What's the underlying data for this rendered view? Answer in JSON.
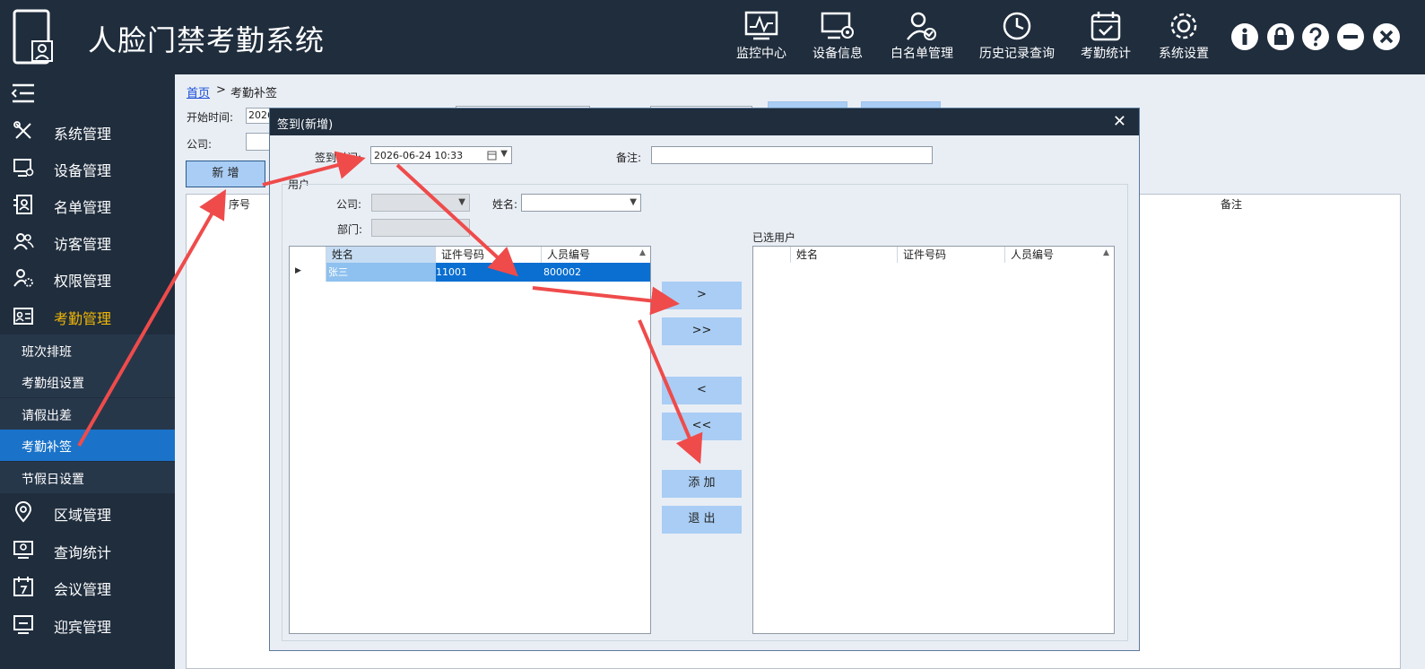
{
  "header": {
    "app_title": "人脸门禁考勤系统",
    "nav": [
      {
        "label": "监控中心",
        "icon": "monitor-chart-icon"
      },
      {
        "label": "设备信息",
        "icon": "device-icon"
      },
      {
        "label": "白名单管理",
        "icon": "user-check-icon"
      },
      {
        "label": "历史记录查询",
        "icon": "history-icon"
      },
      {
        "label": "考勤统计",
        "icon": "calendar-check-icon"
      },
      {
        "label": "系统设置",
        "icon": "gear-icon"
      }
    ],
    "window_buttons": [
      "info-icon",
      "lock-icon",
      "help-icon",
      "minimize-icon",
      "close-icon"
    ]
  },
  "sidebar": {
    "items": [
      {
        "label": "系统管理",
        "icon": "tools-icon"
      },
      {
        "label": "设备管理",
        "icon": "device-manage-icon"
      },
      {
        "label": "名单管理",
        "icon": "name-list-icon"
      },
      {
        "label": "访客管理",
        "icon": "visitor-icon"
      },
      {
        "label": "权限管理",
        "icon": "permission-icon"
      },
      {
        "label": "考勤管理",
        "icon": "attendance-icon"
      },
      {
        "label": "区域管理",
        "icon": "location-icon"
      },
      {
        "label": "查询统计",
        "icon": "query-icon"
      },
      {
        "label": "会议管理",
        "icon": "meeting-icon"
      },
      {
        "label": "迎宾管理",
        "icon": "welcome-icon"
      }
    ],
    "subitems": [
      "班次排班",
      "考勤组设置",
      "请假出差",
      "考勤补签",
      "节假日设置"
    ]
  },
  "main": {
    "breadcrumb_home": "首页",
    "breadcrumb_sep": ">",
    "breadcrumb_current": "考勤补签",
    "start_time_label": "开始时间:",
    "start_time_value": "2026",
    "company_label": "公司:",
    "add_button": "新  增",
    "table_headers": {
      "seq": "序号",
      "remark": "备注"
    }
  },
  "dialog": {
    "title": "签到(新增)",
    "close": "✕",
    "checkin_time_label": "签到时间:",
    "checkin_time_value": "2026-06-24 10:33",
    "remark_label": "备注:",
    "remark_value": "",
    "user_group_label": "用户",
    "company_label": "公司:",
    "name_label": "姓名:",
    "dept_label": "部门:",
    "users_grid": {
      "headers": [
        "姓名",
        "证件号码",
        "人员编号"
      ],
      "rows": [
        {
          "name": "张三",
          "id_no": "11001",
          "emp_no": "800002"
        }
      ]
    },
    "selected_label": "已选用户",
    "selected_grid": {
      "headers": [
        "姓名",
        "证件号码",
        "人员编号"
      ],
      "rows": []
    },
    "buttons": {
      "add_one": ">",
      "add_all": ">>",
      "remove_one": "<",
      "remove_all": "<<",
      "confirm": "添  加",
      "exit": "退  出"
    }
  },
  "colors": {
    "dark": "#1f2d3d",
    "accent": "#1a73c9",
    "active_text": "#f2b705",
    "button": "#a9cdf4",
    "annotation": "#ef4b4b"
  }
}
